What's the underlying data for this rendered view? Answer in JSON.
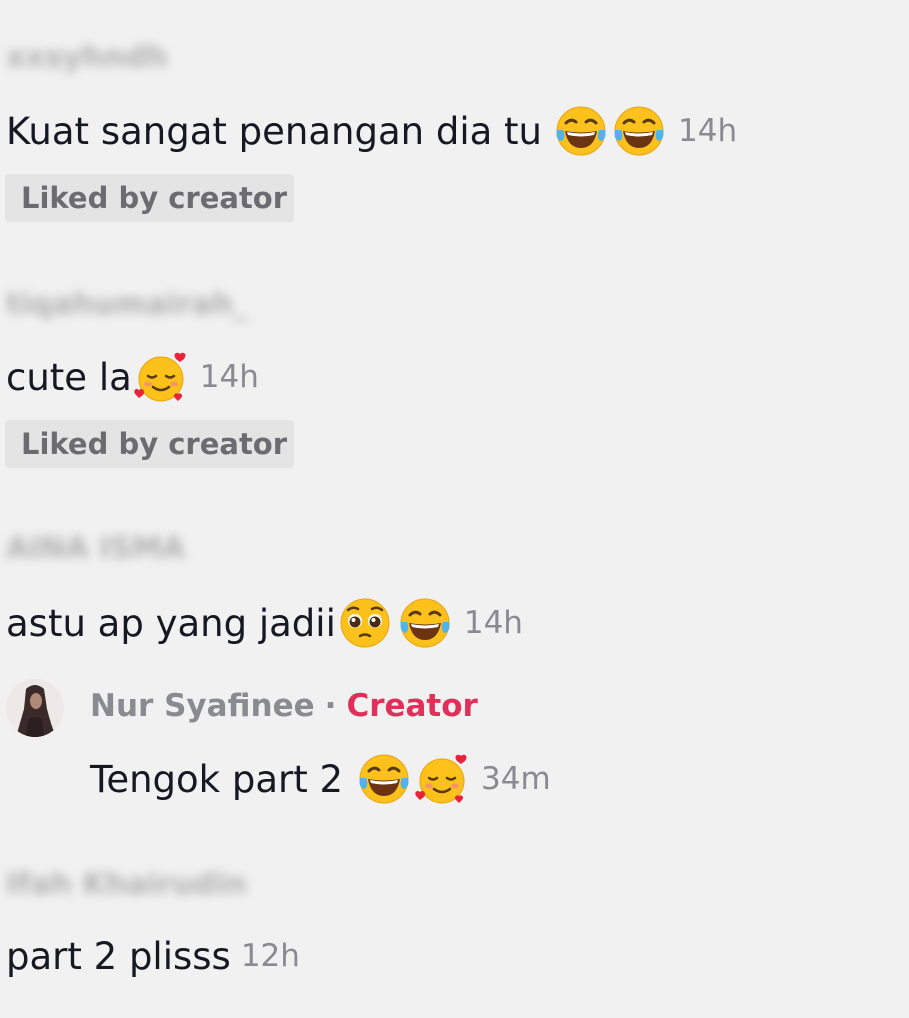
{
  "comments": [
    {
      "username": "xxsyhndh",
      "text": "Kuat sangat penangan dia tu",
      "emojis": [
        "joy-emoji",
        "joy-emoji"
      ],
      "time": "14h",
      "badge": "Liked by creator"
    },
    {
      "username": "tiqahumairah_",
      "text": "cute la",
      "emojis": [
        "smiling-hearts-emoji"
      ],
      "time": "14h",
      "badge": "Liked by creator"
    },
    {
      "username": "AINA ISMA",
      "text": "astu ap yang jadii",
      "emojis": [
        "pleading-emoji",
        "joy-emoji"
      ],
      "time": "14h",
      "reply": {
        "author": "Nur Syafinee",
        "separator": "·",
        "role": "Creator",
        "text": "Tengok part 2",
        "emojis": [
          "joy-emoji",
          "smiling-hearts-emoji"
        ],
        "time": "34m"
      }
    },
    {
      "username": "Ifah Khairudin",
      "text": "part 2 plisss",
      "time": "12h"
    }
  ],
  "colors": {
    "background": "#f2f1f1",
    "creator_accent": "#e0305a",
    "muted_text": "#8a8b91",
    "badge_bg": "#e4e4e4"
  }
}
